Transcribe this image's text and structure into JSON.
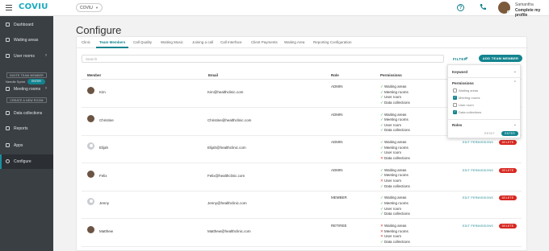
{
  "topbar": {
    "logo": "COVIU",
    "clinic": "COVIU",
    "help_glyph": "?",
    "user_name": "Samantha",
    "profile_link": "Complete my profile"
  },
  "sidebar": {
    "items": [
      {
        "label": "Dashboard",
        "icon": "home-icon"
      },
      {
        "label": "Waiting areas",
        "icon": "waiting-area-icon"
      },
      {
        "label": "User rooms",
        "icon": "user-rooms-icon"
      },
      {
        "label": "Meeting rooms",
        "icon": "meeting-rooms-icon"
      },
      {
        "label": "Data collections",
        "icon": "data-collections-icon"
      },
      {
        "label": "Reports",
        "icon": "reports-icon"
      },
      {
        "label": "Apps",
        "icon": "apps-icon"
      },
      {
        "label": "Configure",
        "icon": "gear-icon"
      }
    ],
    "ready_label": "Needle Sprint",
    "ready_badge": "ENTER",
    "invite_button": "INVITE TEAM MEMBER",
    "create_room_button": "CREATE A NEW ROOM"
  },
  "page": {
    "title": "Configure"
  },
  "tabs": [
    "Clinic",
    "Team Members",
    "Call Quality",
    "Waiting Music",
    "Joining a call",
    "Call Interface",
    "Client Payments",
    "Waiting Area",
    "Reporting Configuration"
  ],
  "toolbar": {
    "search_placeholder": "Search",
    "filter_label": "FILTER",
    "add_button": "ADD TEAM MEMBER"
  },
  "table": {
    "headers": [
      "Member",
      "Email",
      "Role",
      "Permissions"
    ],
    "edit_label": "EDIT PERMISSIONS",
    "delete_label": "DELETE",
    "perm_labels": [
      "Waiting areas",
      "Meeting rooms",
      "User room",
      "Data collections"
    ],
    "rows": [
      {
        "name": "Kim",
        "email": "Kim@healthclinic.com",
        "role": "ADMIN",
        "avatar": "photo",
        "perms": [
          true,
          true,
          true,
          true
        ]
      },
      {
        "name": "Christine",
        "email": "Christine@healthclinic.com",
        "role": "ADMIN",
        "avatar": "photo",
        "perms": [
          true,
          true,
          true,
          true
        ]
      },
      {
        "name": "Elijah",
        "email": "Elijah@healthclinic.com",
        "role": "ADMIN",
        "avatar": "grey",
        "perms": [
          true,
          true,
          true,
          false
        ]
      },
      {
        "name": "Felix",
        "email": "Felix@healthclinic.com",
        "role": "ADMIN",
        "avatar": "photo",
        "perms": [
          true,
          true,
          false,
          true
        ]
      },
      {
        "name": "Jenny",
        "email": "Jenny@healthclinic.com",
        "role": "MEMBER",
        "avatar": "grey",
        "perms": [
          true,
          true,
          true,
          true
        ]
      },
      {
        "name": "Matthew",
        "email": "Matthew@healthclinic.com",
        "role": "RETIREE",
        "avatar": "photo",
        "perms": [
          false,
          false,
          false,
          true
        ]
      }
    ]
  },
  "filter_panel": {
    "keyword_label": "Keyword",
    "permissions_label": "Permissions",
    "options": [
      {
        "label": "Waiting areas",
        "checked": false
      },
      {
        "label": "Meeting rooms",
        "checked": true
      },
      {
        "label": "User room",
        "checked": false
      },
      {
        "label": "Data collections",
        "checked": true
      }
    ],
    "roles_label": "Roles",
    "reset_label": "RESET",
    "enter_label": "ENTER"
  },
  "colors": {
    "accent": "#13848f",
    "sidebar": "#3a3f44",
    "delete": "#d7261e",
    "check": "#2ba84a",
    "cross": "#d73a2e"
  }
}
